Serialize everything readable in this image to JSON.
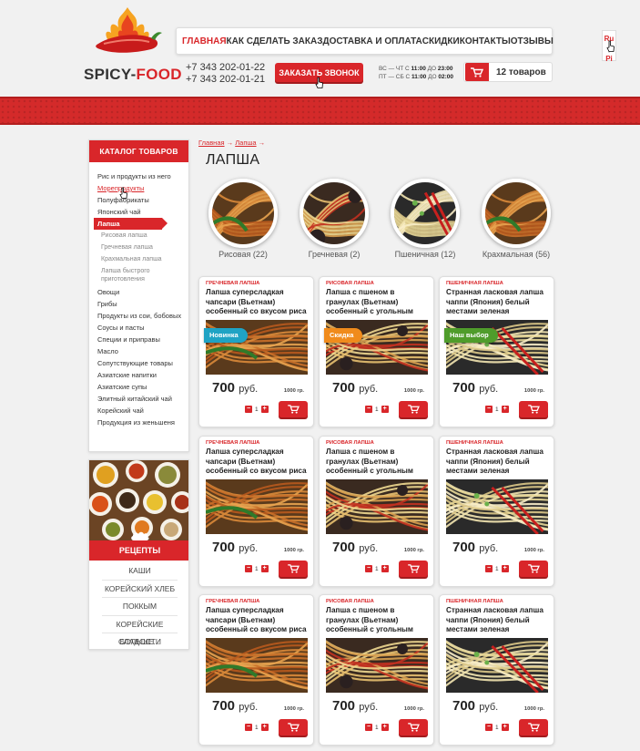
{
  "brand": {
    "name_part1": "SPICY-",
    "name_part2": "FOOD"
  },
  "nav": {
    "items": [
      "ГЛАВНАЯ",
      "КАК СДЕЛАТЬ ЗАКАЗ",
      "ДОСТАВКА И ОПЛАТА",
      "СКИДКИ",
      "КОНТАКТЫ",
      "ОТЗЫВЫ"
    ],
    "active_index": 0
  },
  "language": {
    "ru": "Ru",
    "en": "Pi"
  },
  "header": {
    "phone1": "+7 343 202-01-22",
    "phone2": "+7 343 202-01-21",
    "callback_label": "ЗАКАЗАТЬ ЗВОНОК",
    "hours": {
      "row1_prefix": "ВС — ЧТ С ",
      "row1_from": "11:00",
      "row1_mid": " ДО ",
      "row1_to": "23:00",
      "row2_prefix": "ПТ — СБ С ",
      "row2_from": "11:00",
      "row2_mid": " ДО ",
      "row2_to": "02:00"
    },
    "cart_label": "12 товаров"
  },
  "sidebar": {
    "catalog_title": "КАТАЛОГ ТОВАРОВ",
    "items": [
      {
        "label": "Рис и продукты из него",
        "type": "item"
      },
      {
        "label": "Морепродукты",
        "type": "hover"
      },
      {
        "label": "Полуфабрикаты",
        "type": "item"
      },
      {
        "label": "Японский чай",
        "type": "item"
      },
      {
        "label": "Лапша",
        "type": "active"
      },
      {
        "label": "Рисовая лапша",
        "type": "sub"
      },
      {
        "label": "Гречневая лапша",
        "type": "sub"
      },
      {
        "label": "Крахмальная лапша",
        "type": "sub"
      },
      {
        "label": "Лапша быстрого приготовления",
        "type": "sub2"
      },
      {
        "label": "Овощи",
        "type": "item"
      },
      {
        "label": "Грибы",
        "type": "item"
      },
      {
        "label": "Продукты из сои, бобовых",
        "type": "item2"
      },
      {
        "label": "Соусы и пасты",
        "type": "item"
      },
      {
        "label": "Специи и приправы",
        "type": "item"
      },
      {
        "label": "Масло",
        "type": "item"
      },
      {
        "label": "Сопутствующие товары",
        "type": "item"
      },
      {
        "label": "Азиатские напитки",
        "type": "item"
      },
      {
        "label": "Азиатские супы",
        "type": "item"
      },
      {
        "label": "Элитный китайский чай",
        "type": "item"
      },
      {
        "label": "Корейский чай",
        "type": "item"
      },
      {
        "label": "Продукция из женьшеня",
        "type": "item"
      }
    ],
    "recipes_title": "РЕЦЕПТЫ",
    "recipes": [
      "КАШИ",
      "КОРЕЙСКИЙ ХЛЕБ",
      "ПОККЫМ",
      "КОРЕЙСКИЕ СЛАДОСТИ",
      "БОЛЬШЕ..."
    ]
  },
  "breadcrumb": {
    "home": "Главная",
    "section": "Лапша",
    "sep": "→"
  },
  "page_title": "ЛАПША",
  "subcategories": [
    {
      "label": "Рисовая (22)"
    },
    {
      "label": "Гречневая (2)"
    },
    {
      "label": "Пшеничная (12)"
    },
    {
      "label": "Крахмальная (56)"
    }
  ],
  "colors": {
    "accent": "#d9262a",
    "badge_new": "#1fa3c4",
    "badge_sale": "#f08b1c",
    "badge_choice": "#4f9c2b"
  },
  "products": [
    {
      "category": "ГРЕЧНЕВАЯ ЛАПША",
      "name": "Лапша суперсладкая чапсари (Вьетнам) особенный со вкусом риса",
      "badge": "Новинка",
      "badge_kind": "new",
      "price": "700",
      "currency": "руб.",
      "weight": "1000 гр.",
      "qty": "1",
      "photo": "spicy"
    },
    {
      "category": "РИСОВАЯ ЛАПША",
      "name": "Лапша с пшеном в гранулах (Вьетнам) особенный с угольным",
      "badge": "Скидка",
      "badge_kind": "sale",
      "price": "700",
      "currency": "руб.",
      "weight": "1000 гр.",
      "qty": "1",
      "photo": "mushroom"
    },
    {
      "category": "ПШЕНИЧНАЯ ЛАПША",
      "name": "Странная ласковая лапша чаппи (Япония) белый местами зеленая",
      "badge": "Наш выбор",
      "badge_kind": "choice",
      "price": "700",
      "currency": "руб.",
      "weight": "1000 гр.",
      "qty": "1",
      "photo": "plain"
    },
    {
      "category": "ГРЕЧНЕВАЯ ЛАПША",
      "name": "Лапша суперсладкая чапсари (Вьетнам) особенный со вкусом риса",
      "badge": "",
      "badge_kind": "",
      "price": "700",
      "currency": "руб.",
      "weight": "1000 гр.",
      "qty": "1",
      "photo": "spicy"
    },
    {
      "category": "РИСОВАЯ ЛАПША",
      "name": "Лапша с пшеном в гранулах (Вьетнам) особенный с угольным",
      "badge": "",
      "badge_kind": "",
      "price": "700",
      "currency": "руб.",
      "weight": "1000 гр.",
      "qty": "1",
      "photo": "mushroom"
    },
    {
      "category": "ПШЕНИЧНАЯ ЛАПША",
      "name": "Странная ласковая лапша чаппи (Япония) белый местами зеленая",
      "badge": "",
      "badge_kind": "",
      "price": "700",
      "currency": "руб.",
      "weight": "1000 гр.",
      "qty": "1",
      "photo": "plain"
    },
    {
      "category": "ГРЕЧНЕВАЯ ЛАПША",
      "name": "Лапша суперсладкая чапсари (Вьетнам) особенный со вкусом риса",
      "badge": "",
      "badge_kind": "",
      "price": "700",
      "currency": "руб.",
      "weight": "1000 гр.",
      "qty": "1",
      "photo": "spicy"
    },
    {
      "category": "РИСОВАЯ ЛАПША",
      "name": "Лапша с пшеном в гранулах (Вьетнам) особенный с угольным",
      "badge": "",
      "badge_kind": "",
      "price": "700",
      "currency": "руб.",
      "weight": "1000 гр.",
      "qty": "1",
      "photo": "mushroom"
    },
    {
      "category": "ПШЕНИЧНАЯ ЛАПША",
      "name": "Странная ласковая лапша чаппи (Япония) белый местами зеленая",
      "badge": "",
      "badge_kind": "",
      "price": "700",
      "currency": "руб.",
      "weight": "1000 гр.",
      "qty": "1",
      "photo": "plain"
    }
  ]
}
